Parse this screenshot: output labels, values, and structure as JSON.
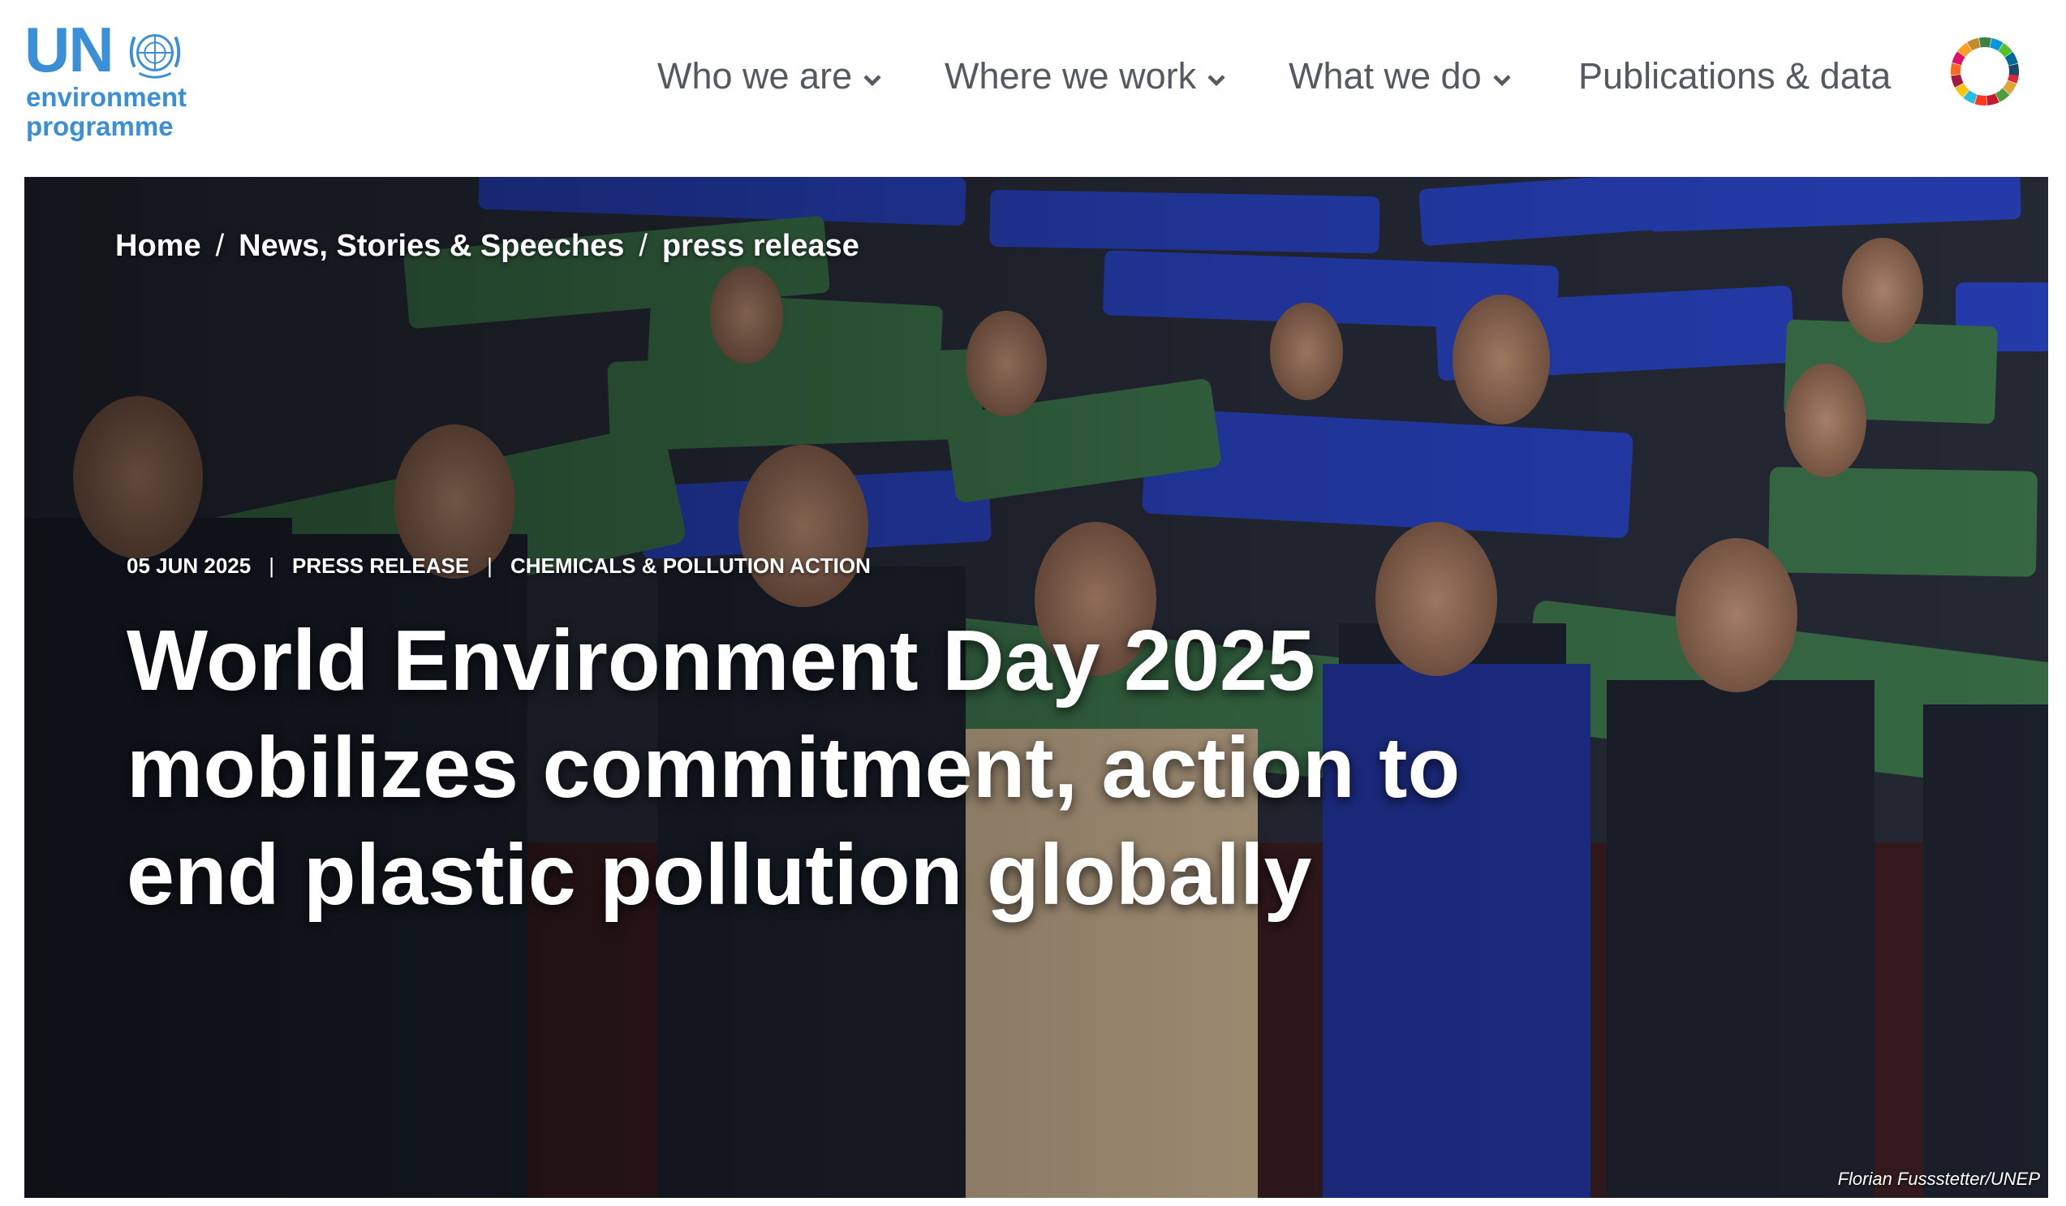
{
  "logo": {
    "un": "UN",
    "line1": "environment",
    "line2": "programme"
  },
  "nav": {
    "items": [
      {
        "label": "Who we are",
        "has_dropdown": true
      },
      {
        "label": "Where we work",
        "has_dropdown": true
      },
      {
        "label": "What we do",
        "has_dropdown": true
      },
      {
        "label": "Publications & data",
        "has_dropdown": false
      }
    ],
    "sdg_icon": "sdg-wheel-icon"
  },
  "colors": {
    "brand_blue": "#3a8fd6",
    "nav_text": "#555a60",
    "banner_blue": "#2a45c8",
    "banner_green": "#3f7a4f"
  },
  "hero": {
    "breadcrumb": [
      "Home",
      "News, Stories & Speeches",
      "press release"
    ],
    "meta": {
      "date": "05 JUN 2025",
      "type": "PRESS RELEASE",
      "topic": "CHEMICALS & POLLUTION ACTION"
    },
    "headline": "World Environment Day 2025 mobilizes commitment, action to end plastic pollution globally",
    "photo_credit": "Florian Fussstetter/UNEP"
  }
}
